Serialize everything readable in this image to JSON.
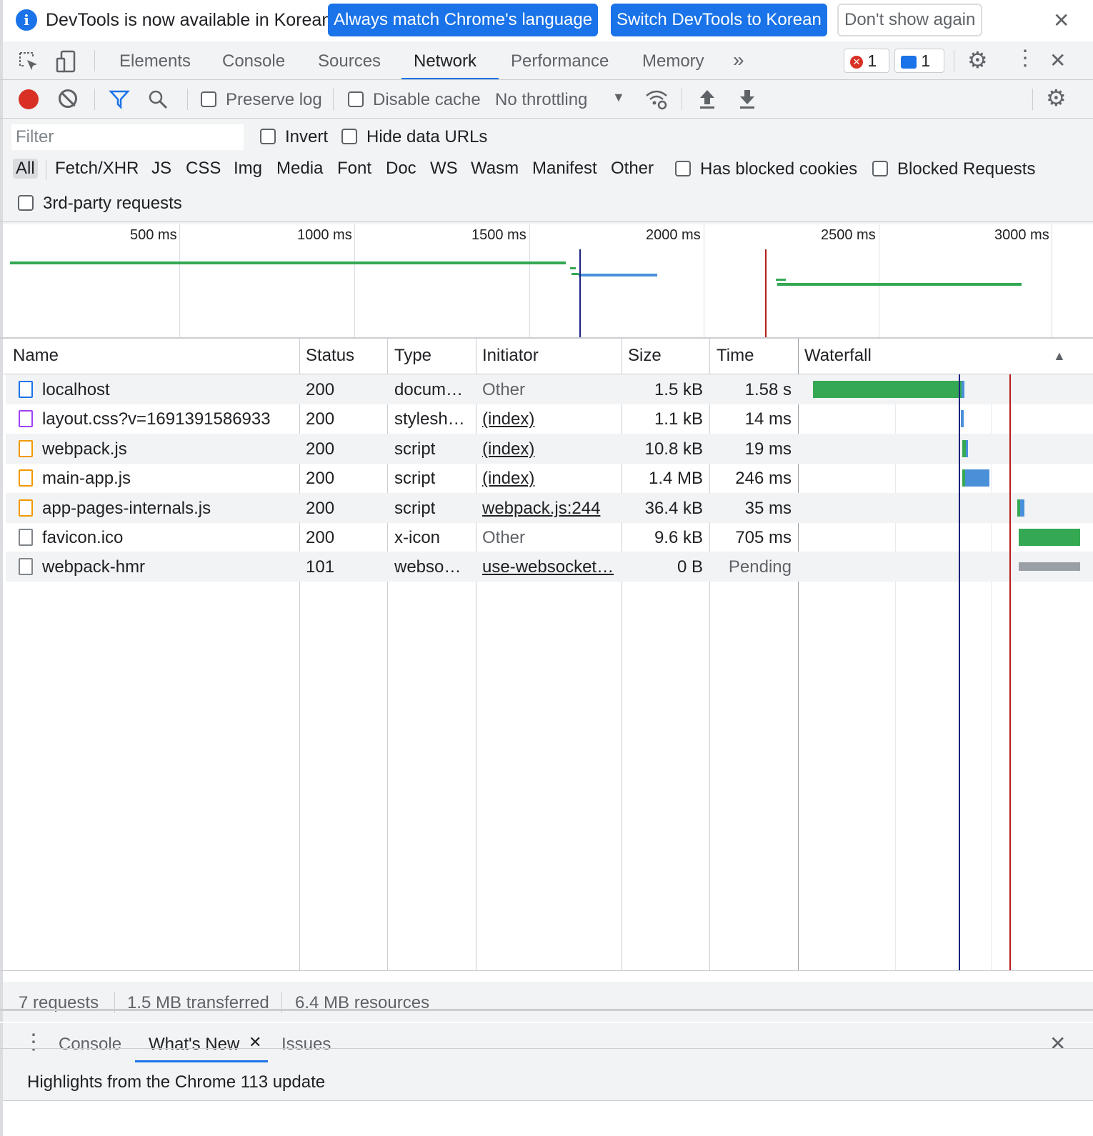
{
  "infobar": {
    "message": "DevTools is now available in Korean!",
    "btn_match": "Always match Chrome's language",
    "btn_switch": "Switch DevTools to Korean",
    "btn_dismiss": "Don't show again"
  },
  "tabs": {
    "items": [
      "Elements",
      "Console",
      "Sources",
      "Network",
      "Performance",
      "Memory"
    ],
    "active": "Network",
    "error_count": "1",
    "message_count": "1"
  },
  "toolbar": {
    "preserve_log": "Preserve log",
    "disable_cache": "Disable cache",
    "throttling": "No throttling"
  },
  "filter": {
    "placeholder": "Filter",
    "invert": "Invert",
    "hide_data_urls": "Hide data URLs",
    "types": [
      "All",
      "Fetch/XHR",
      "JS",
      "CSS",
      "Img",
      "Media",
      "Font",
      "Doc",
      "WS",
      "Wasm",
      "Manifest",
      "Other"
    ],
    "has_blocked_cookies": "Has blocked cookies",
    "blocked_requests": "Blocked Requests",
    "third_party": "3rd-party requests"
  },
  "overview": {
    "ticks": [
      "500 ms",
      "1000 ms",
      "1500 ms",
      "2000 ms",
      "2500 ms",
      "3000 ms"
    ]
  },
  "table": {
    "headers": [
      "Name",
      "Status",
      "Type",
      "Initiator",
      "Size",
      "Time",
      "Waterfall"
    ],
    "rows": [
      {
        "name": "localhost",
        "status": "200",
        "type": "docum…",
        "initiator": "Other",
        "size": "1.5 kB",
        "time": "1.58 s",
        "icon": "document-icon"
      },
      {
        "name": "layout.css?v=1691391586933",
        "status": "200",
        "type": "stylesh…",
        "initiator": "(index)",
        "size": "1.1 kB",
        "time": "14 ms",
        "icon": "stylesheet-icon"
      },
      {
        "name": "webpack.js",
        "status": "200",
        "type": "script",
        "initiator": "(index)",
        "size": "10.8 kB",
        "time": "19 ms",
        "icon": "script-icon"
      },
      {
        "name": "main-app.js",
        "status": "200",
        "type": "script",
        "initiator": "(index)",
        "size": "1.4 MB",
        "time": "246 ms",
        "icon": "script-icon"
      },
      {
        "name": "app-pages-internals.js",
        "status": "200",
        "type": "script",
        "initiator": "webpack.js:244",
        "size": "36.4 kB",
        "time": "35 ms",
        "icon": "script-icon"
      },
      {
        "name": "favicon.ico",
        "status": "200",
        "type": "x-icon",
        "initiator": "Other",
        "size": "9.6 kB",
        "time": "705 ms",
        "icon": "file-icon"
      },
      {
        "name": "webpack-hmr",
        "status": "101",
        "type": "webso…",
        "initiator": "use-websocket…",
        "size": "0 B",
        "time": "Pending",
        "icon": "file-icon"
      }
    ]
  },
  "summary": {
    "requests": "7 requests",
    "transferred": "1.5 MB transferred",
    "resources": "6.4 MB resources"
  },
  "drawer": {
    "tabs": [
      "Console",
      "What's New",
      "Issues"
    ],
    "active": "What's New",
    "headline": "Highlights from the Chrome 113 update"
  },
  "colors": {
    "accent": "#1a73e8",
    "record": "#d93025",
    "waiting": "#34a853",
    "download": "#4a90d9",
    "dom_content_loaded": "#1a237e",
    "load": "#b71c1c"
  }
}
